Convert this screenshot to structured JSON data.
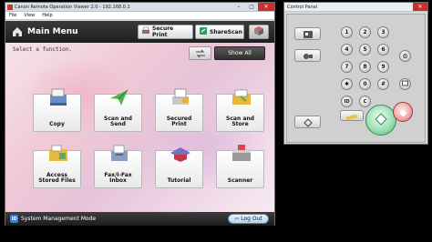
{
  "main_window": {
    "title": "Canon Remote Operation Viewer 2.0 - 192.168.0.1",
    "menu": [
      "File",
      "View",
      "Help"
    ],
    "header": {
      "title": "Main Menu",
      "secure_print_label": "Secure Print",
      "sharescan_label": "ShareScan"
    },
    "prompt": "Select a function.",
    "show_all_label": "Show All",
    "functions": [
      {
        "label": "Copy",
        "icon": "copy-icon"
      },
      {
        "label": "Scan and\nSend",
        "icon": "scan-send-icon"
      },
      {
        "label": "Secured\nPrint",
        "icon": "secured-print-icon"
      },
      {
        "label": "Scan and\nStore",
        "icon": "scan-store-icon"
      },
      {
        "label": "Access\nStored Files",
        "icon": "stored-files-icon"
      },
      {
        "label": "Fax/I-Fax\nInbox",
        "icon": "fax-inbox-icon"
      },
      {
        "label": "Tutorial",
        "icon": "tutorial-icon"
      },
      {
        "label": "Scanner",
        "icon": "scanner-icon"
      }
    ],
    "footer": {
      "id_badge": "ID",
      "mode_label": "System Management Mode",
      "logout_label": "Log Out"
    }
  },
  "control_panel": {
    "title": "Control Panel",
    "keys": [
      "1",
      "2",
      "3",
      "4",
      "5",
      "6",
      "7",
      "8",
      "9",
      "✱",
      "0",
      "#"
    ],
    "id_key": "ID",
    "c_key": "C"
  },
  "colors": {
    "accent_dark": "#2a2a2a",
    "start_green": "#4fae74",
    "stop_red": "#c75b5b",
    "close_red": "#c9302c"
  }
}
